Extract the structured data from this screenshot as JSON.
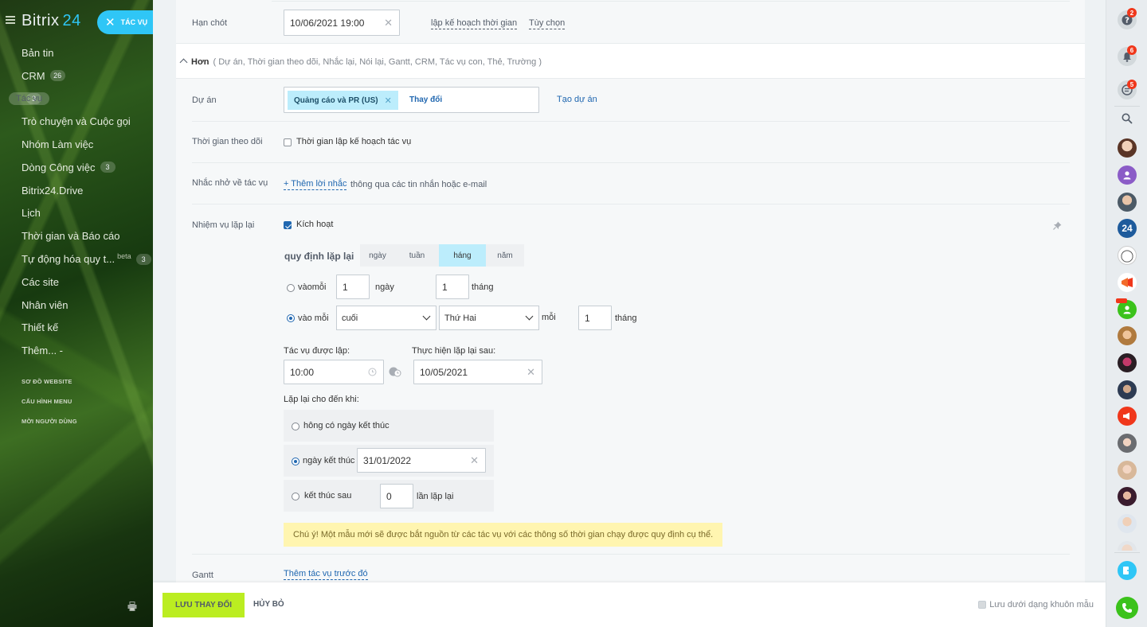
{
  "sidebar": {
    "logo_text": "Bitrix",
    "logo_num": "24",
    "task_button": "TÁC VỤ",
    "items": [
      {
        "label": "Bản tin"
      },
      {
        "label": "CRM",
        "count": "26"
      },
      {
        "label": "Tác vụ",
        "count": "3"
      },
      {
        "label": "Trò chuyện và Cuộc gọi"
      },
      {
        "label": "Nhóm Làm việc"
      },
      {
        "label": "Dòng Công việc",
        "count": "3"
      },
      {
        "label": "Bitrix24.Drive"
      },
      {
        "label": "Lịch"
      },
      {
        "label": "Thời gian và Báo cáo"
      },
      {
        "label": "Tự động hóa quy t...",
        "beta": "beta",
        "count": "3"
      },
      {
        "label": "Các site"
      },
      {
        "label": "Nhân viên"
      },
      {
        "label": "Thiết kế"
      },
      {
        "label": "Thêm... -"
      }
    ],
    "links": [
      "SƠ ĐỒ WEBSITE",
      "CẤU HÌNH MENU",
      "MỜI NGƯỜI DÙNG"
    ]
  },
  "form": {
    "deadline": {
      "label": "Hạn chót",
      "value": "10/06/2021 19:00",
      "plan_link": "lập kế hoạch thời gian",
      "options_link": "Tùy chọn"
    },
    "more": {
      "title": "Hơn",
      "extras": "( Dự án,  Thời gian theo dõi,  Nhắc lại,  Nói lại,  Gantt,  CRM,  Tác vụ con,  Thẻ,  Trường )"
    },
    "project": {
      "label": "Dự án",
      "tag": "Quảng cáo và PR (US)",
      "change": "Thay đổi",
      "create": "Tạo dự án"
    },
    "tracking": {
      "label": "Thời gian theo dõi",
      "checkbox": "Thời gian lập kế hoạch tác vụ"
    },
    "reminder": {
      "label": "Nhắc nhở về tác vụ",
      "add_link": "+ Thêm lời nhắc",
      "suffix": "thông qua các tin nhắn hoặc e-mail"
    },
    "repeat": {
      "label": "Nhiệm vụ lặp lại",
      "enable": "Kích hoạt",
      "rule_label": "quy định lặp lại",
      "tabs": [
        "ngày",
        "tuần",
        "háng",
        "năm"
      ],
      "row1": {
        "prefix": "vàomỗi",
        "day_value": "1",
        "day_unit": "ngày",
        "month_value": "1",
        "month_unit": "tháng"
      },
      "row2": {
        "prefix": "vào mỗi",
        "which": "cuối",
        "weekday": "Thứ Hai",
        "each": "mỗi",
        "month_value": "1",
        "month_unit": "tháng"
      },
      "created_label": "Tác vụ được lập:",
      "created_time": "10:00",
      "start_label": "Thực hiện lặp lại sau:",
      "start_date": "10/05/2021",
      "until_label": "Lặp lại cho đến khi:",
      "no_end": "hông có ngày kết thúc",
      "end_date_label": "ngày kết thúc",
      "end_date": "31/01/2022",
      "end_after_label": "kết thúc sau",
      "end_after_value": "0",
      "end_after_suffix": "lần lặp lại",
      "warning": "Chú ý! Một mẫu mới sẽ được bắt nguồn từ các tác vụ với các thông số thời gian chạy được quy định cụ thể."
    },
    "gantt": {
      "label": "Gantt",
      "link": "Thêm tác vụ trước đó"
    }
  },
  "footer": {
    "save": "LƯU THAY ĐỔI",
    "cancel": "HỦY BỎ",
    "template": "Lưu dưới dạng khuôn mẫu"
  },
  "rightbar": {
    "badges": {
      "help": "2",
      "notifications": "6",
      "messages": "5"
    },
    "avatar_24": "24"
  }
}
